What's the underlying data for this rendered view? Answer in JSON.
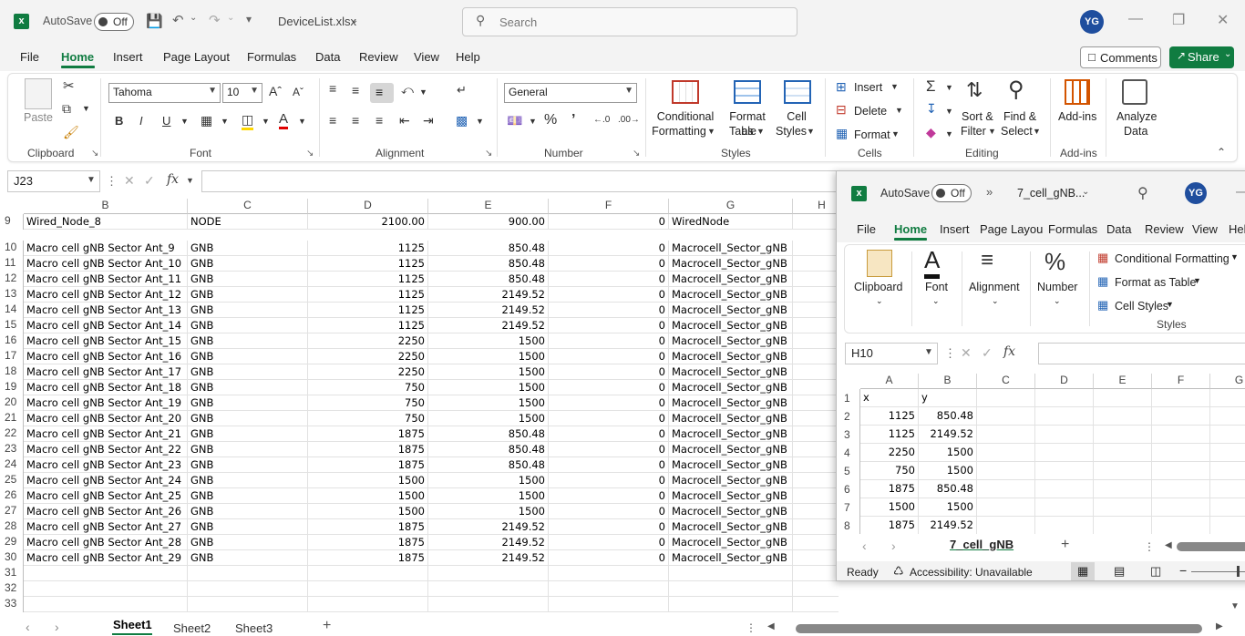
{
  "app": {
    "autosave_label": "AutoSave",
    "autosave_state": "Off",
    "filename": "DeviceList.xlsx",
    "search_placeholder": "Search",
    "user_initials": "YG"
  },
  "tabs": [
    "File",
    "Home",
    "Insert",
    "Page Layout",
    "Formulas",
    "Data",
    "Review",
    "View",
    "Help"
  ],
  "actions": {
    "comments": "Comments",
    "share": "Share"
  },
  "ribbon": {
    "clipboard": {
      "paste": "Paste",
      "group": "Clipboard"
    },
    "font": {
      "name": "Tahoma",
      "size": "10",
      "group": "Font"
    },
    "alignment": {
      "group": "Alignment"
    },
    "number": {
      "format": "General",
      "group": "Number"
    },
    "styles": {
      "cond1": "Conditional",
      "cond2": "Formatting",
      "fmt1": "Format as",
      "fmt2": "Table",
      "cell1": "Cell",
      "cell2": "Styles",
      "group": "Styles"
    },
    "cells": {
      "insert": "Insert",
      "delete": "Delete",
      "format": "Format",
      "group": "Cells"
    },
    "editing": {
      "sort1": "Sort &",
      "sort2": "Filter",
      "find1": "Find &",
      "find2": "Select",
      "group": "Editing"
    },
    "addins": {
      "label": "Add-ins",
      "group": "Add-ins"
    },
    "analyze": {
      "l1": "Analyze",
      "l2": "Data"
    }
  },
  "namebox": "J23",
  "columns": [
    "B",
    "C",
    "D",
    "E",
    "F",
    "G",
    "H"
  ],
  "rows": [
    {
      "n": "9",
      "b": "Wired_Node_8",
      "c": "NODE",
      "d": "2100.00",
      "e": "900.00",
      "f": "0",
      "g": "WiredNode"
    },
    {
      "n": "10",
      "b": "Macro cell gNB Sector Ant_9",
      "c": "GNB",
      "d": "1125",
      "e": "850.48",
      "f": "0",
      "g": "Macrocell_Sector_gNB"
    },
    {
      "n": "11",
      "b": "Macro cell gNB Sector Ant_10",
      "c": "GNB",
      "d": "1125",
      "e": "850.48",
      "f": "0",
      "g": "Macrocell_Sector_gNB"
    },
    {
      "n": "12",
      "b": "Macro cell gNB Sector Ant_11",
      "c": "GNB",
      "d": "1125",
      "e": "850.48",
      "f": "0",
      "g": "Macrocell_Sector_gNB"
    },
    {
      "n": "13",
      "b": "Macro cell gNB Sector Ant_12",
      "c": "GNB",
      "d": "1125",
      "e": "2149.52",
      "f": "0",
      "g": "Macrocell_Sector_gNB"
    },
    {
      "n": "14",
      "b": "Macro cell gNB Sector Ant_13",
      "c": "GNB",
      "d": "1125",
      "e": "2149.52",
      "f": "0",
      "g": "Macrocell_Sector_gNB"
    },
    {
      "n": "15",
      "b": "Macro cell gNB Sector Ant_14",
      "c": "GNB",
      "d": "1125",
      "e": "2149.52",
      "f": "0",
      "g": "Macrocell_Sector_gNB"
    },
    {
      "n": "16",
      "b": "Macro cell gNB Sector Ant_15",
      "c": "GNB",
      "d": "2250",
      "e": "1500",
      "f": "0",
      "g": "Macrocell_Sector_gNB"
    },
    {
      "n": "17",
      "b": "Macro cell gNB Sector Ant_16",
      "c": "GNB",
      "d": "2250",
      "e": "1500",
      "f": "0",
      "g": "Macrocell_Sector_gNB"
    },
    {
      "n": "18",
      "b": "Macro cell gNB Sector Ant_17",
      "c": "GNB",
      "d": "2250",
      "e": "1500",
      "f": "0",
      "g": "Macrocell_Sector_gNB"
    },
    {
      "n": "19",
      "b": "Macro cell gNB Sector Ant_18",
      "c": "GNB",
      "d": "750",
      "e": "1500",
      "f": "0",
      "g": "Macrocell_Sector_gNB"
    },
    {
      "n": "20",
      "b": "Macro cell gNB Sector Ant_19",
      "c": "GNB",
      "d": "750",
      "e": "1500",
      "f": "0",
      "g": "Macrocell_Sector_gNB"
    },
    {
      "n": "21",
      "b": "Macro cell gNB Sector Ant_20",
      "c": "GNB",
      "d": "750",
      "e": "1500",
      "f": "0",
      "g": "Macrocell_Sector_gNB"
    },
    {
      "n": "22",
      "b": "Macro cell gNB Sector Ant_21",
      "c": "GNB",
      "d": "1875",
      "e": "850.48",
      "f": "0",
      "g": "Macrocell_Sector_gNB"
    },
    {
      "n": "23",
      "b": "Macro cell gNB Sector Ant_22",
      "c": "GNB",
      "d": "1875",
      "e": "850.48",
      "f": "0",
      "g": "Macrocell_Sector_gNB"
    },
    {
      "n": "24",
      "b": "Macro cell gNB Sector Ant_23",
      "c": "GNB",
      "d": "1875",
      "e": "850.48",
      "f": "0",
      "g": "Macrocell_Sector_gNB"
    },
    {
      "n": "25",
      "b": "Macro cell gNB Sector Ant_24",
      "c": "GNB",
      "d": "1500",
      "e": "1500",
      "f": "0",
      "g": "Macrocell_Sector_gNB"
    },
    {
      "n": "26",
      "b": "Macro cell gNB Sector Ant_25",
      "c": "GNB",
      "d": "1500",
      "e": "1500",
      "f": "0",
      "g": "Macrocell_Sector_gNB"
    },
    {
      "n": "27",
      "b": "Macro cell gNB Sector Ant_26",
      "c": "GNB",
      "d": "1500",
      "e": "1500",
      "f": "0",
      "g": "Macrocell_Sector_gNB"
    },
    {
      "n": "28",
      "b": "Macro cell gNB Sector Ant_27",
      "c": "GNB",
      "d": "1875",
      "e": "2149.52",
      "f": "0",
      "g": "Macrocell_Sector_gNB"
    },
    {
      "n": "29",
      "b": "Macro cell gNB Sector Ant_28",
      "c": "GNB",
      "d": "1875",
      "e": "2149.52",
      "f": "0",
      "g": "Macrocell_Sector_gNB"
    },
    {
      "n": "30",
      "b": "Macro cell gNB Sector Ant_29",
      "c": "GNB",
      "d": "1875",
      "e": "2149.52",
      "f": "0",
      "g": "Macrocell_Sector_gNB"
    },
    {
      "n": "31",
      "b": "",
      "c": "",
      "d": "",
      "e": "",
      "f": "",
      "g": ""
    },
    {
      "n": "32",
      "b": "",
      "c": "",
      "d": "",
      "e": "",
      "f": "",
      "g": ""
    },
    {
      "n": "33",
      "b": "",
      "c": "",
      "d": "",
      "e": "",
      "f": "",
      "g": ""
    }
  ],
  "sheets": [
    "Sheet1",
    "Sheet2",
    "Sheet3"
  ],
  "second_window": {
    "autosave_label": "AutoSave",
    "autosave_state": "Off",
    "filename": "7_cell_gNB...",
    "user_initials": "YG",
    "tabs": [
      "File",
      "Home",
      "Insert",
      "Page Layou",
      "Formulas",
      "Data",
      "Review",
      "View",
      "Hel"
    ],
    "ribbon": {
      "clipboard": "Clipboard",
      "font": "Font",
      "alignment": "Alignment",
      "number": "Number",
      "cond": "Conditional Formatting",
      "fmt": "Format as Table",
      "cellstyles": "Cell Styles",
      "group": "Styles"
    },
    "namebox": "H10",
    "columns": [
      "A",
      "B",
      "C",
      "D",
      "E",
      "F",
      "G"
    ],
    "rows": [
      {
        "n": "1",
        "a": "x",
        "b": "y"
      },
      {
        "n": "2",
        "a": "1125",
        "b": "850.48"
      },
      {
        "n": "3",
        "a": "1125",
        "b": "2149.52"
      },
      {
        "n": "4",
        "a": "2250",
        "b": "1500"
      },
      {
        "n": "5",
        "a": "750",
        "b": "1500"
      },
      {
        "n": "6",
        "a": "1875",
        "b": "850.48"
      },
      {
        "n": "7",
        "a": "1500",
        "b": "1500"
      },
      {
        "n": "8",
        "a": "1875",
        "b": "2149.52"
      }
    ],
    "sheet": "7_cell_gNB",
    "status": "Ready",
    "accessibility": "Accessibility: Unavailable"
  },
  "colors": {
    "excel_green": "#107c41",
    "avatar": "#1f4e9e"
  }
}
